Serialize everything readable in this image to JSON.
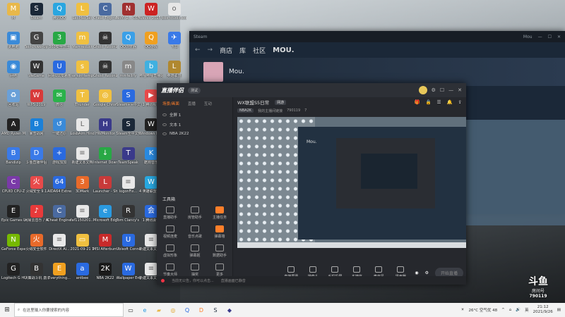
{
  "desktop": {
    "icons": [
      {
        "label": "M",
        "color": "#e8b84a",
        "glyph": "M",
        "col": 0,
        "row": 0
      },
      {
        "label": "Steam",
        "color": "#1b2838",
        "glyph": "S",
        "col": 1,
        "row": 0
      },
      {
        "label": "腾讯QQ",
        "color": "#2aa6e0",
        "glyph": "Q",
        "col": 2,
        "row": 0
      },
      {
        "label": "LeoMaxTao",
        "color": "#f0c040",
        "glyph": "L",
        "col": 3,
        "row": 0
      },
      {
        "label": "Cheat Engine...",
        "color": "#4a6aa0",
        "glyph": "C",
        "col": 4,
        "row": 0
      },
      {
        "label": "NoMi 2... COM的",
        "color": "#a03030",
        "glyph": "N",
        "col": 5,
        "row": 0
      },
      {
        "label": "Waves 2015 Legend",
        "color": "#cc2222",
        "glyph": "W",
        "col": 6,
        "row": 0
      },
      {
        "label": "obs-studio.exe",
        "color": "#e6e6e6",
        "glyph": "o",
        "col": 7,
        "row": 0
      },
      {
        "label": "此电脑",
        "color": "#3a8ad8",
        "glyph": "▣",
        "col": 0,
        "row": 1
      },
      {
        "label": "TechPowerUp GPU-Z",
        "color": "#444",
        "glyph": "G",
        "col": 1,
        "row": 1
      },
      {
        "label": "360安全卫士",
        "color": "#28a845",
        "glyph": "3",
        "col": 2,
        "row": 1
      },
      {
        "label": "Memreduct",
        "color": "#f0c040",
        "glyph": "m",
        "col": 3,
        "row": 1
      },
      {
        "label": "Ghost Recon的...",
        "color": "#333",
        "glyph": "☠",
        "col": 4,
        "row": 1
      },
      {
        "label": "QQ浏览器",
        "color": "#3aa0e8",
        "glyph": "Q",
        "col": 5,
        "row": 1
      },
      {
        "label": "QQ游戏",
        "color": "#f0a020",
        "glyph": "Q",
        "col": 6,
        "row": 1
      },
      {
        "label": "飞书",
        "color": "#3a7ae8",
        "glyph": "✈",
        "col": 7,
        "row": 1
      },
      {
        "label": "网络",
        "color": "#3a8ad8",
        "glyph": "◉",
        "col": 0,
        "row": 2
      },
      {
        "label": "WeGame",
        "color": "#333",
        "glyph": "W",
        "col": 1,
        "row": 2
      },
      {
        "label": "网易UU加速器",
        "color": "#2a6ae0",
        "glyph": "U",
        "col": 2,
        "row": 2
      },
      {
        "label": "ss_sin_temp",
        "color": "#f0c040",
        "glyph": "s",
        "col": 3,
        "row": 2
      },
      {
        "label": "Ghost Recon的...",
        "color": "#333",
        "glyph": "☠",
        "col": 4,
        "row": 2
      },
      {
        "label": "mmfellify",
        "color": "#888",
        "glyph": "m",
        "col": 5,
        "row": 2
      },
      {
        "label": "哔哩哔哩直播姬",
        "color": "#40b0e0",
        "glyph": "b",
        "col": 6,
        "row": 2
      },
      {
        "label": "英雄联盟",
        "color": "#b08830",
        "glyph": "L",
        "col": 7,
        "row": 2
      },
      {
        "label": "回收站",
        "color": "#6aa0d8",
        "glyph": "♻",
        "col": 0,
        "row": 3
      },
      {
        "label": "WPS 2019",
        "color": "#d83a3a",
        "glyph": "W",
        "col": 1,
        "row": 3
      },
      {
        "label": "微信",
        "color": "#2ab24a",
        "glyph": "✉",
        "col": 2,
        "row": 3
      },
      {
        "label": "Thunder",
        "color": "#f0c040",
        "glyph": "T",
        "col": 3,
        "row": 3
      },
      {
        "label": "Google Chrome",
        "color": "#f0c040",
        "glyph": "◎",
        "col": 4,
        "row": 3
      },
      {
        "label": "Steam++中文CDN服务",
        "color": "#2a6ae0",
        "glyph": "S",
        "col": 5,
        "row": 3
      },
      {
        "label": "1 腾讯视频",
        "color": "#e84a4a",
        "glyph": "▶",
        "col": 6,
        "row": 3
      },
      {
        "label": "AMD Ryzen Master",
        "color": "#222",
        "glyph": "A",
        "col": 0,
        "row": 4
      },
      {
        "label": "暴雪战网",
        "color": "#1a80d8",
        "glyph": "B",
        "col": 1,
        "row": 4
      },
      {
        "label": "一键还原",
        "color": "#3a8ad8",
        "glyph": "↺",
        "col": 2,
        "row": 4
      },
      {
        "label": "LosbAim Hinds Editor",
        "color": "#e8e8e8",
        "glyph": "L",
        "col": 3,
        "row": 4
      },
      {
        "label": "HWMonitor",
        "color": "#3a3a8a",
        "glyph": "H",
        "col": 4,
        "row": 4
      },
      {
        "label": "Steam全中文体验...",
        "color": "#1b2838",
        "glyph": "S",
        "col": 5,
        "row": 4
      },
      {
        "label": "Windows Medi...",
        "color": "#222",
        "glyph": "W",
        "col": 6,
        "row": 4
      },
      {
        "label": "Bandizip",
        "color": "#3a7ae8",
        "glyph": "B",
        "col": 0,
        "row": 5
      },
      {
        "label": "斗鱼直播伴侣",
        "color": "#3a7ae8",
        "glyph": "D",
        "col": 1,
        "row": 5
      },
      {
        "label": "游戏加加",
        "color": "#2a6ae0",
        "glyph": "+",
        "col": 2,
        "row": 5
      },
      {
        "label": "新建文本文档",
        "color": "#e8e8e8",
        "glyph": "≡",
        "col": 3,
        "row": 5
      },
      {
        "label": "Internet Downlo...",
        "color": "#28a845",
        "glyph": "↓",
        "col": 4,
        "row": 5
      },
      {
        "label": "TeamSpeak",
        "color": "#3a3a8a",
        "glyph": "T",
        "col": 5,
        "row": 5
      },
      {
        "label": "酷狗音乐",
        "color": "#2a8ae0",
        "glyph": "K",
        "col": 6,
        "row": 5
      },
      {
        "label": "CPUID CPU-Z",
        "color": "#7a3aa8",
        "glyph": "C",
        "col": 0,
        "row": 6
      },
      {
        "label": "火绒安全 9.1",
        "color": "#e84a4a",
        "glyph": "火",
        "col": 1,
        "row": 6
      },
      {
        "label": "AIDA64 Extreme",
        "color": "#2a6ae0",
        "glyph": "64",
        "col": 2,
        "row": 6
      },
      {
        "label": "3DMark",
        "color": "#e86a2a",
        "glyph": "3",
        "col": 3,
        "row": 6
      },
      {
        "label": "Launcher - Shortcut",
        "color": "#c83a3a",
        "glyph": "L",
        "col": 4,
        "row": 6
      },
      {
        "label": "logonFix...",
        "color": "#e8e8e8",
        "glyph": "≡",
        "col": 5,
        "row": 6
      },
      {
        "label": "4 英雄联盟WeGame版",
        "color": "#28a8e0",
        "glyph": "W",
        "col": 6,
        "row": 6
      },
      {
        "label": "Epic Games Launcher",
        "color": "#222",
        "glyph": "E",
        "col": 0,
        "row": 7
      },
      {
        "label": "网易云音乐 / 美国手机",
        "color": "#e83a3a",
        "glyph": "♪",
        "col": 1,
        "row": 7
      },
      {
        "label": "Cheat Engine 7.2",
        "color": "#4a6aa0",
        "glyph": "C",
        "col": 2,
        "row": 7
      },
      {
        "label": "faf1150201...",
        "color": "#e8e8e8",
        "glyph": "≡",
        "col": 3,
        "row": 7
      },
      {
        "label": "Microsoft Edge",
        "color": "#2a9ae0",
        "glyph": "e",
        "col": 4,
        "row": 7
      },
      {
        "label": "Tom Clancy's R...",
        "color": "#333",
        "glyph": "R",
        "col": 5,
        "row": 7
      },
      {
        "label": "1 腾讯会议",
        "color": "#2a6ae0",
        "glyph": "会",
        "col": 6,
        "row": 7
      },
      {
        "label": "GeForce Experience",
        "color": "#76b900",
        "glyph": "N",
        "col": 0,
        "row": 8
      },
      {
        "label": "火绒安全软件",
        "color": "#e86a2a",
        "glyph": "火",
        "col": 1,
        "row": 8
      },
      {
        "label": "DirectX Ai...",
        "color": "#e8e8e8",
        "glyph": "≡",
        "col": 2,
        "row": 8
      },
      {
        "label": "2021-09-21 15-14-04",
        "color": "#f0c040",
        "glyph": "▭",
        "col": 3,
        "row": 8
      },
      {
        "label": "MSI Afterburner",
        "color": "#c82a2a",
        "glyph": "M",
        "col": 4,
        "row": 8
      },
      {
        "label": "Ubisoft Connect",
        "color": "#2a6ae0",
        "glyph": "U",
        "col": 5,
        "row": 8
      },
      {
        "label": "新建文本文档 (2)",
        "color": "#e8e8e8",
        "glyph": "≡",
        "col": 6,
        "row": 8
      },
      {
        "label": "Logitech G HUB",
        "color": "#222",
        "glyph": "G",
        "col": 0,
        "row": 9
      },
      {
        "label": "决策战斗机 激活版修改",
        "color": "#333",
        "glyph": "B",
        "col": 1,
        "row": 9
      },
      {
        "label": "Everything...",
        "color": "#f0a020",
        "glyph": "E",
        "col": 2,
        "row": 9
      },
      {
        "label": "antbee",
        "color": "#2a6ae0",
        "glyph": "a",
        "col": 3,
        "row": 9
      },
      {
        "label": "NBA 2K22",
        "color": "#1a1a1a",
        "glyph": "2K",
        "col": 4,
        "row": 9
      },
      {
        "label": "Wallpaper Engine...",
        "color": "#2a6ae0",
        "glyph": "W",
        "col": 5,
        "row": 9
      },
      {
        "label": "新建文本文档 (3)",
        "color": "#e8e8e8",
        "glyph": "≡",
        "col": 6,
        "row": 9
      }
    ]
  },
  "steam_window": {
    "titlebar": "Steam",
    "nav": [
      "商店",
      "库",
      "社区",
      "MOU."
    ],
    "back": "←",
    "forward": "→",
    "profile_name": "Mou.",
    "user": "Mou"
  },
  "app": {
    "logo": "直播伴侣",
    "version": "测试",
    "title_controls": [
      "⚙",
      "☐",
      "—",
      "✕"
    ],
    "side_tabs": [
      "场景/画面",
      "直播",
      "互动"
    ],
    "scenes": [
      "全屏 1",
      "文本 1",
      "NBA 2K22"
    ],
    "tools_header": "工具箱",
    "tools": [
      {
        "label": "直播助手",
        "orange": false
      },
      {
        "label": "房管助手",
        "orange": false
      },
      {
        "label": "主播任务",
        "orange": true
      },
      {
        "label": "视频连麦",
        "orange": false
      },
      {
        "label": "音乐点歌",
        "orange": false
      },
      {
        "label": "弹幕墙",
        "orange": true
      },
      {
        "label": "虚拟形象",
        "orange": false
      },
      {
        "label": "弹幕姬",
        "orange": false
      },
      {
        "label": "数据助手",
        "orange": false
      },
      {
        "label": "节奏大师",
        "orange": false
      },
      {
        "label": "抽奖",
        "orange": false
      },
      {
        "label": "更多",
        "orange": false
      }
    ],
    "stream_title": "WX联盟S5日常",
    "stream_tag": "网游",
    "game_badge": "NBA2K",
    "sub_info": "我的主播间链接",
    "room_no": "790119",
    "online": "7",
    "preview_mou": "Mou.",
    "controls": [
      "直播屏幕",
      "摄像头",
      "手机投屏",
      "多媒体",
      "麦克风",
      "扬声器"
    ],
    "live_button": "开始直播",
    "status": [
      "当前无公告，你可以点击...",
      "直播画面已静音"
    ]
  },
  "taskbar": {
    "search_placeholder": "在这里输入你要搜索的内容",
    "weather": "26°C 空气优 48",
    "time": "21:12",
    "date": "2021/9/26",
    "lang": "英"
  },
  "watermark": {
    "brand": "斗鱼",
    "sub": "房间号",
    "room": "790119"
  }
}
